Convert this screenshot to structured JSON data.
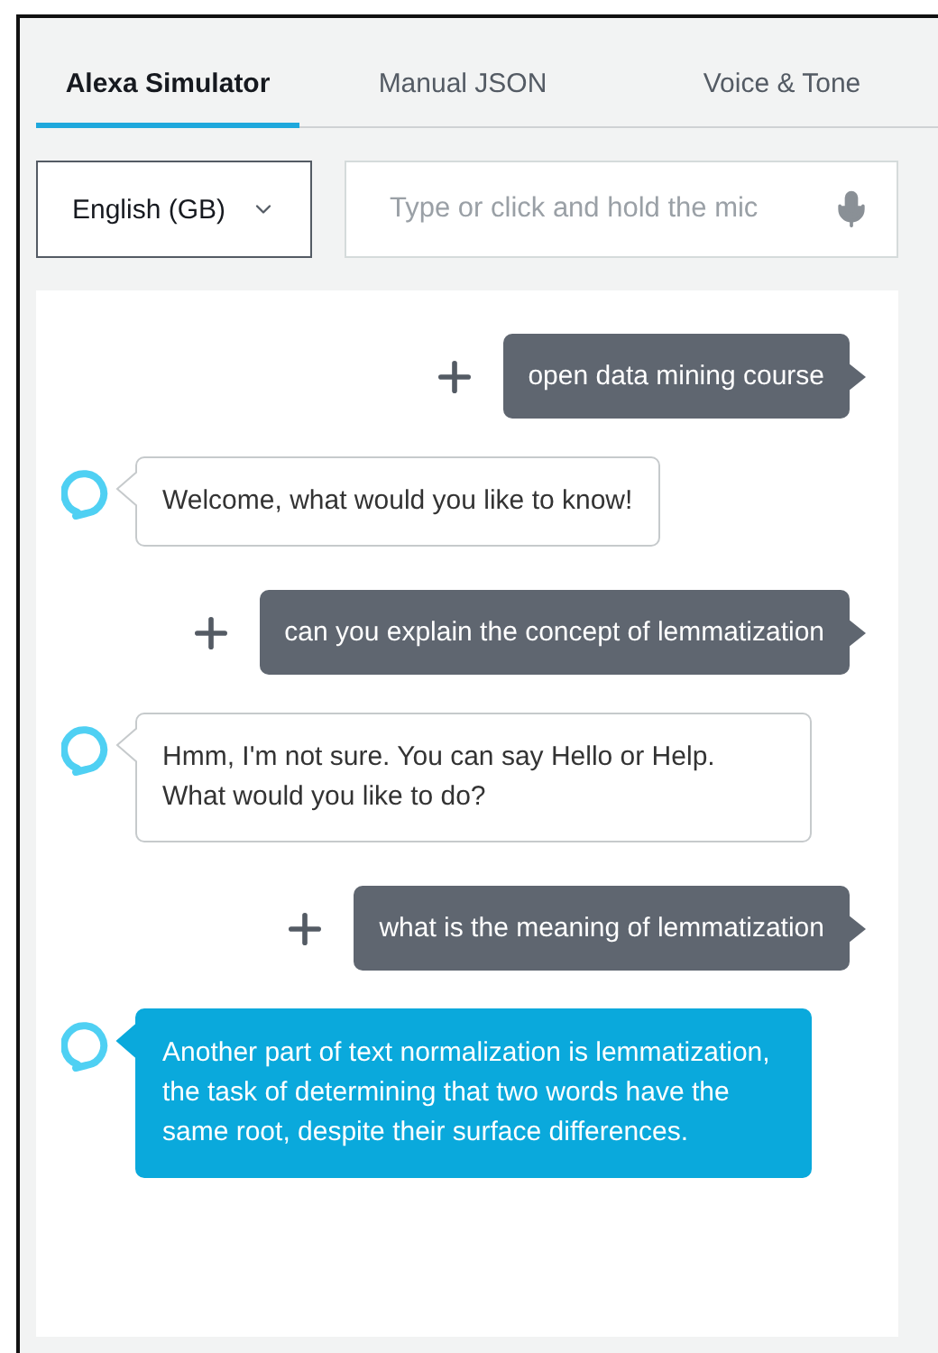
{
  "tabs": [
    {
      "label": "Alexa Simulator",
      "selected": true
    },
    {
      "label": "Manual JSON",
      "selected": false
    },
    {
      "label": "Voice & Tone",
      "selected": false
    }
  ],
  "locale": {
    "value": "English (GB)"
  },
  "utterance": {
    "placeholder": "Type or click and hold the mic"
  },
  "messages": [
    {
      "kind": "user",
      "text": "open data mining course"
    },
    {
      "kind": "alexa",
      "text": "Welcome, what would you like to know!",
      "selected": false
    },
    {
      "kind": "user",
      "text": "can you explain the concept of lemmatization"
    },
    {
      "kind": "alexa",
      "text": "Hmm, I'm not sure. You can say Hello or Help. What would you like to do?",
      "selected": false
    },
    {
      "kind": "user",
      "text": "what is the meaning of lemmatization"
    },
    {
      "kind": "alexa",
      "text": "Another part of text normalization is lemmatization, the task of determining that two words have the same root, despite their surface differences.",
      "selected": true
    }
  ]
}
